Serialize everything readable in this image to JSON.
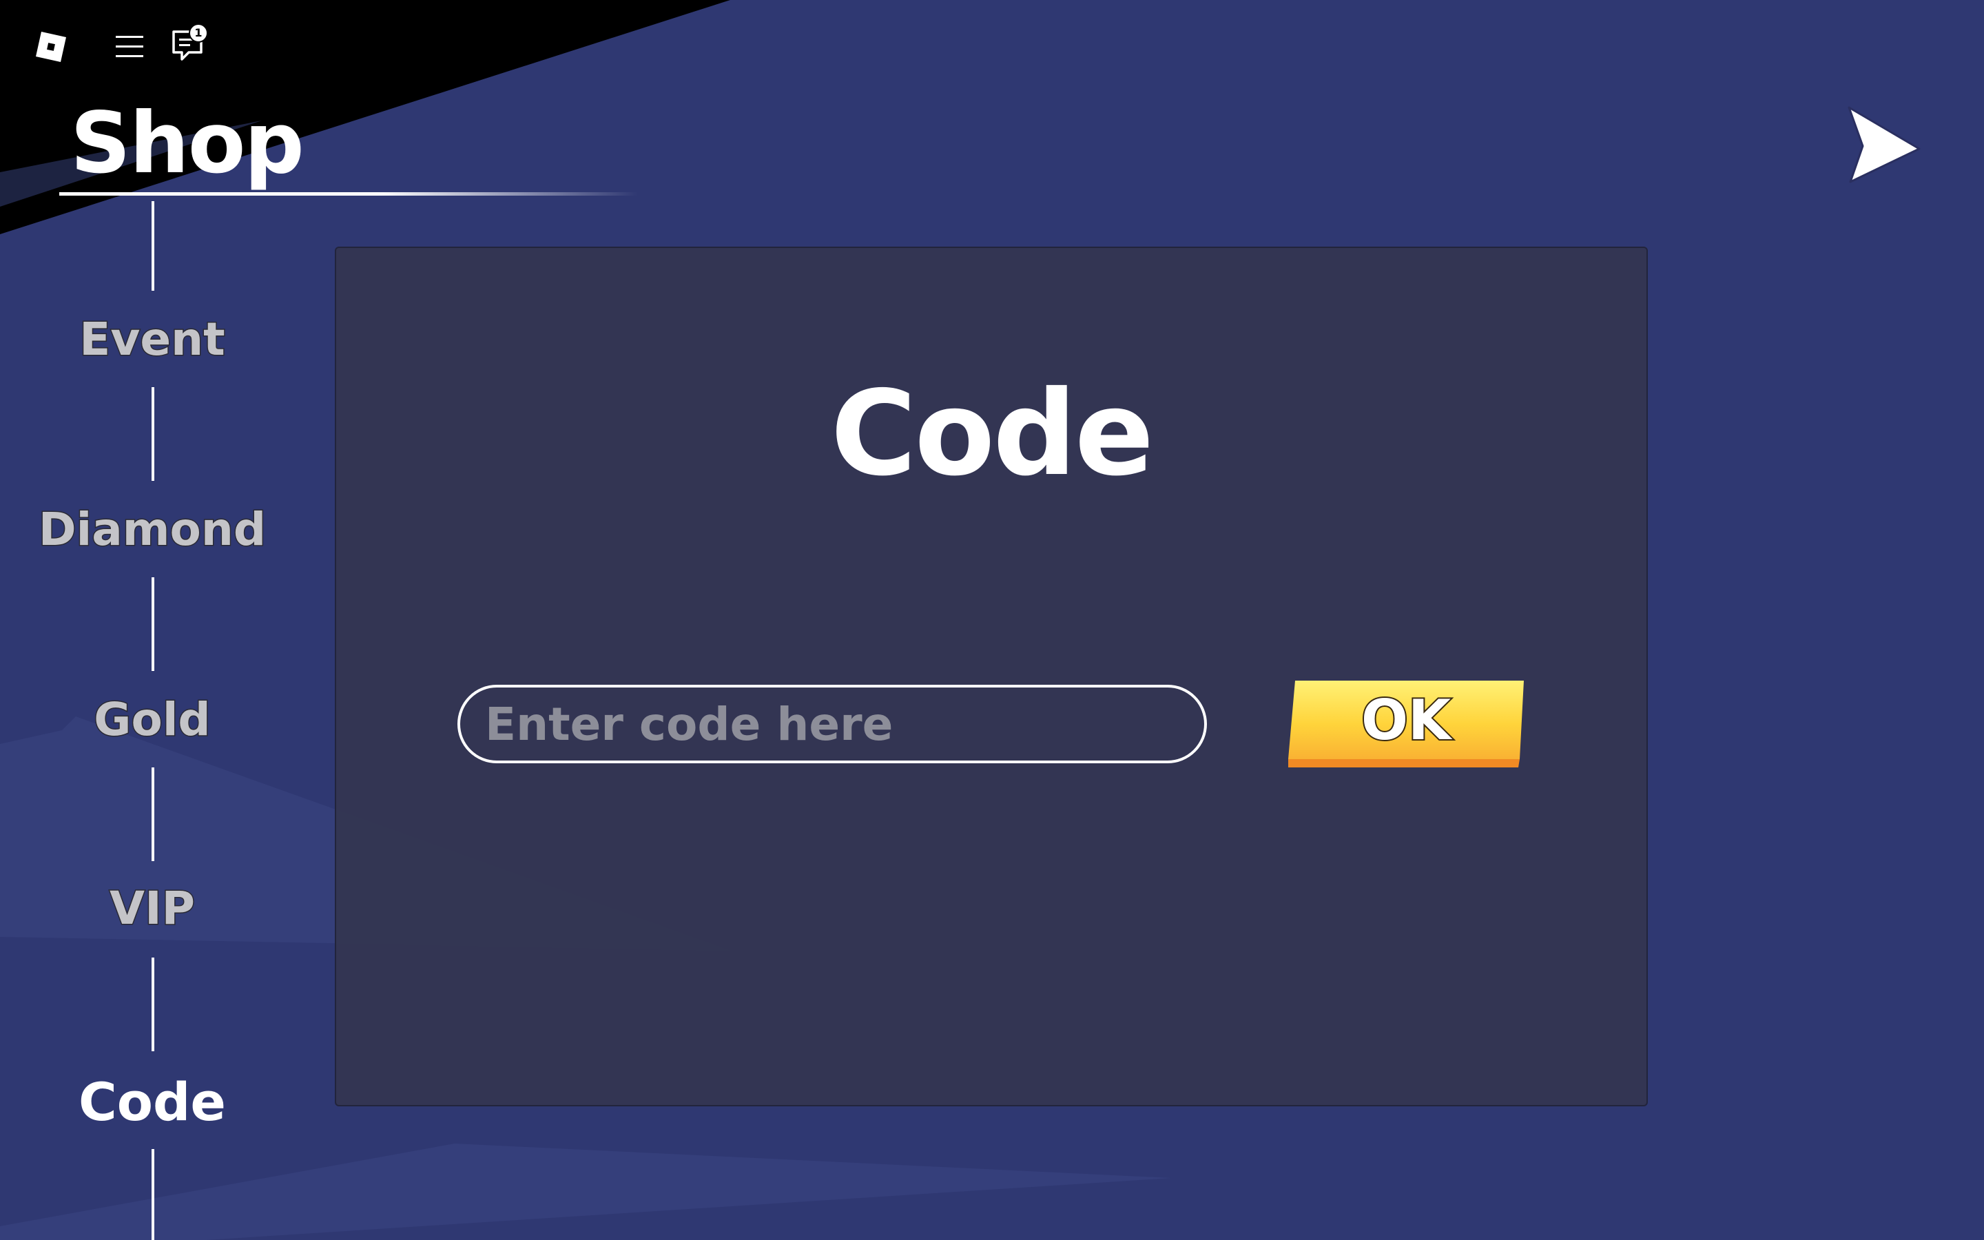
{
  "topbar": {
    "logo_icon": "roblox-logo-icon",
    "menu_icon": "hamburger-menu-icon",
    "chat_icon": "chat-icon",
    "chat_badge_count": "1"
  },
  "shop": {
    "title": "Shop",
    "close_icon": "arrow-right-icon"
  },
  "nav": {
    "items": [
      {
        "label": "Event",
        "active": false
      },
      {
        "label": "Diamond",
        "active": false
      },
      {
        "label": "Gold",
        "active": false
      },
      {
        "label": "VIP",
        "active": false
      },
      {
        "label": "Code",
        "active": true
      }
    ]
  },
  "panel": {
    "title": "Code",
    "input_placeholder": "Enter code here",
    "input_value": "",
    "ok_label": "OK"
  },
  "colors": {
    "background": "#2f3872",
    "panel": "#343652",
    "ok_button_top": "#ffe356",
    "ok_button_bottom": "#f5a623",
    "nav_inactive": "#c4c4c8",
    "nav_active": "#ffffff"
  }
}
